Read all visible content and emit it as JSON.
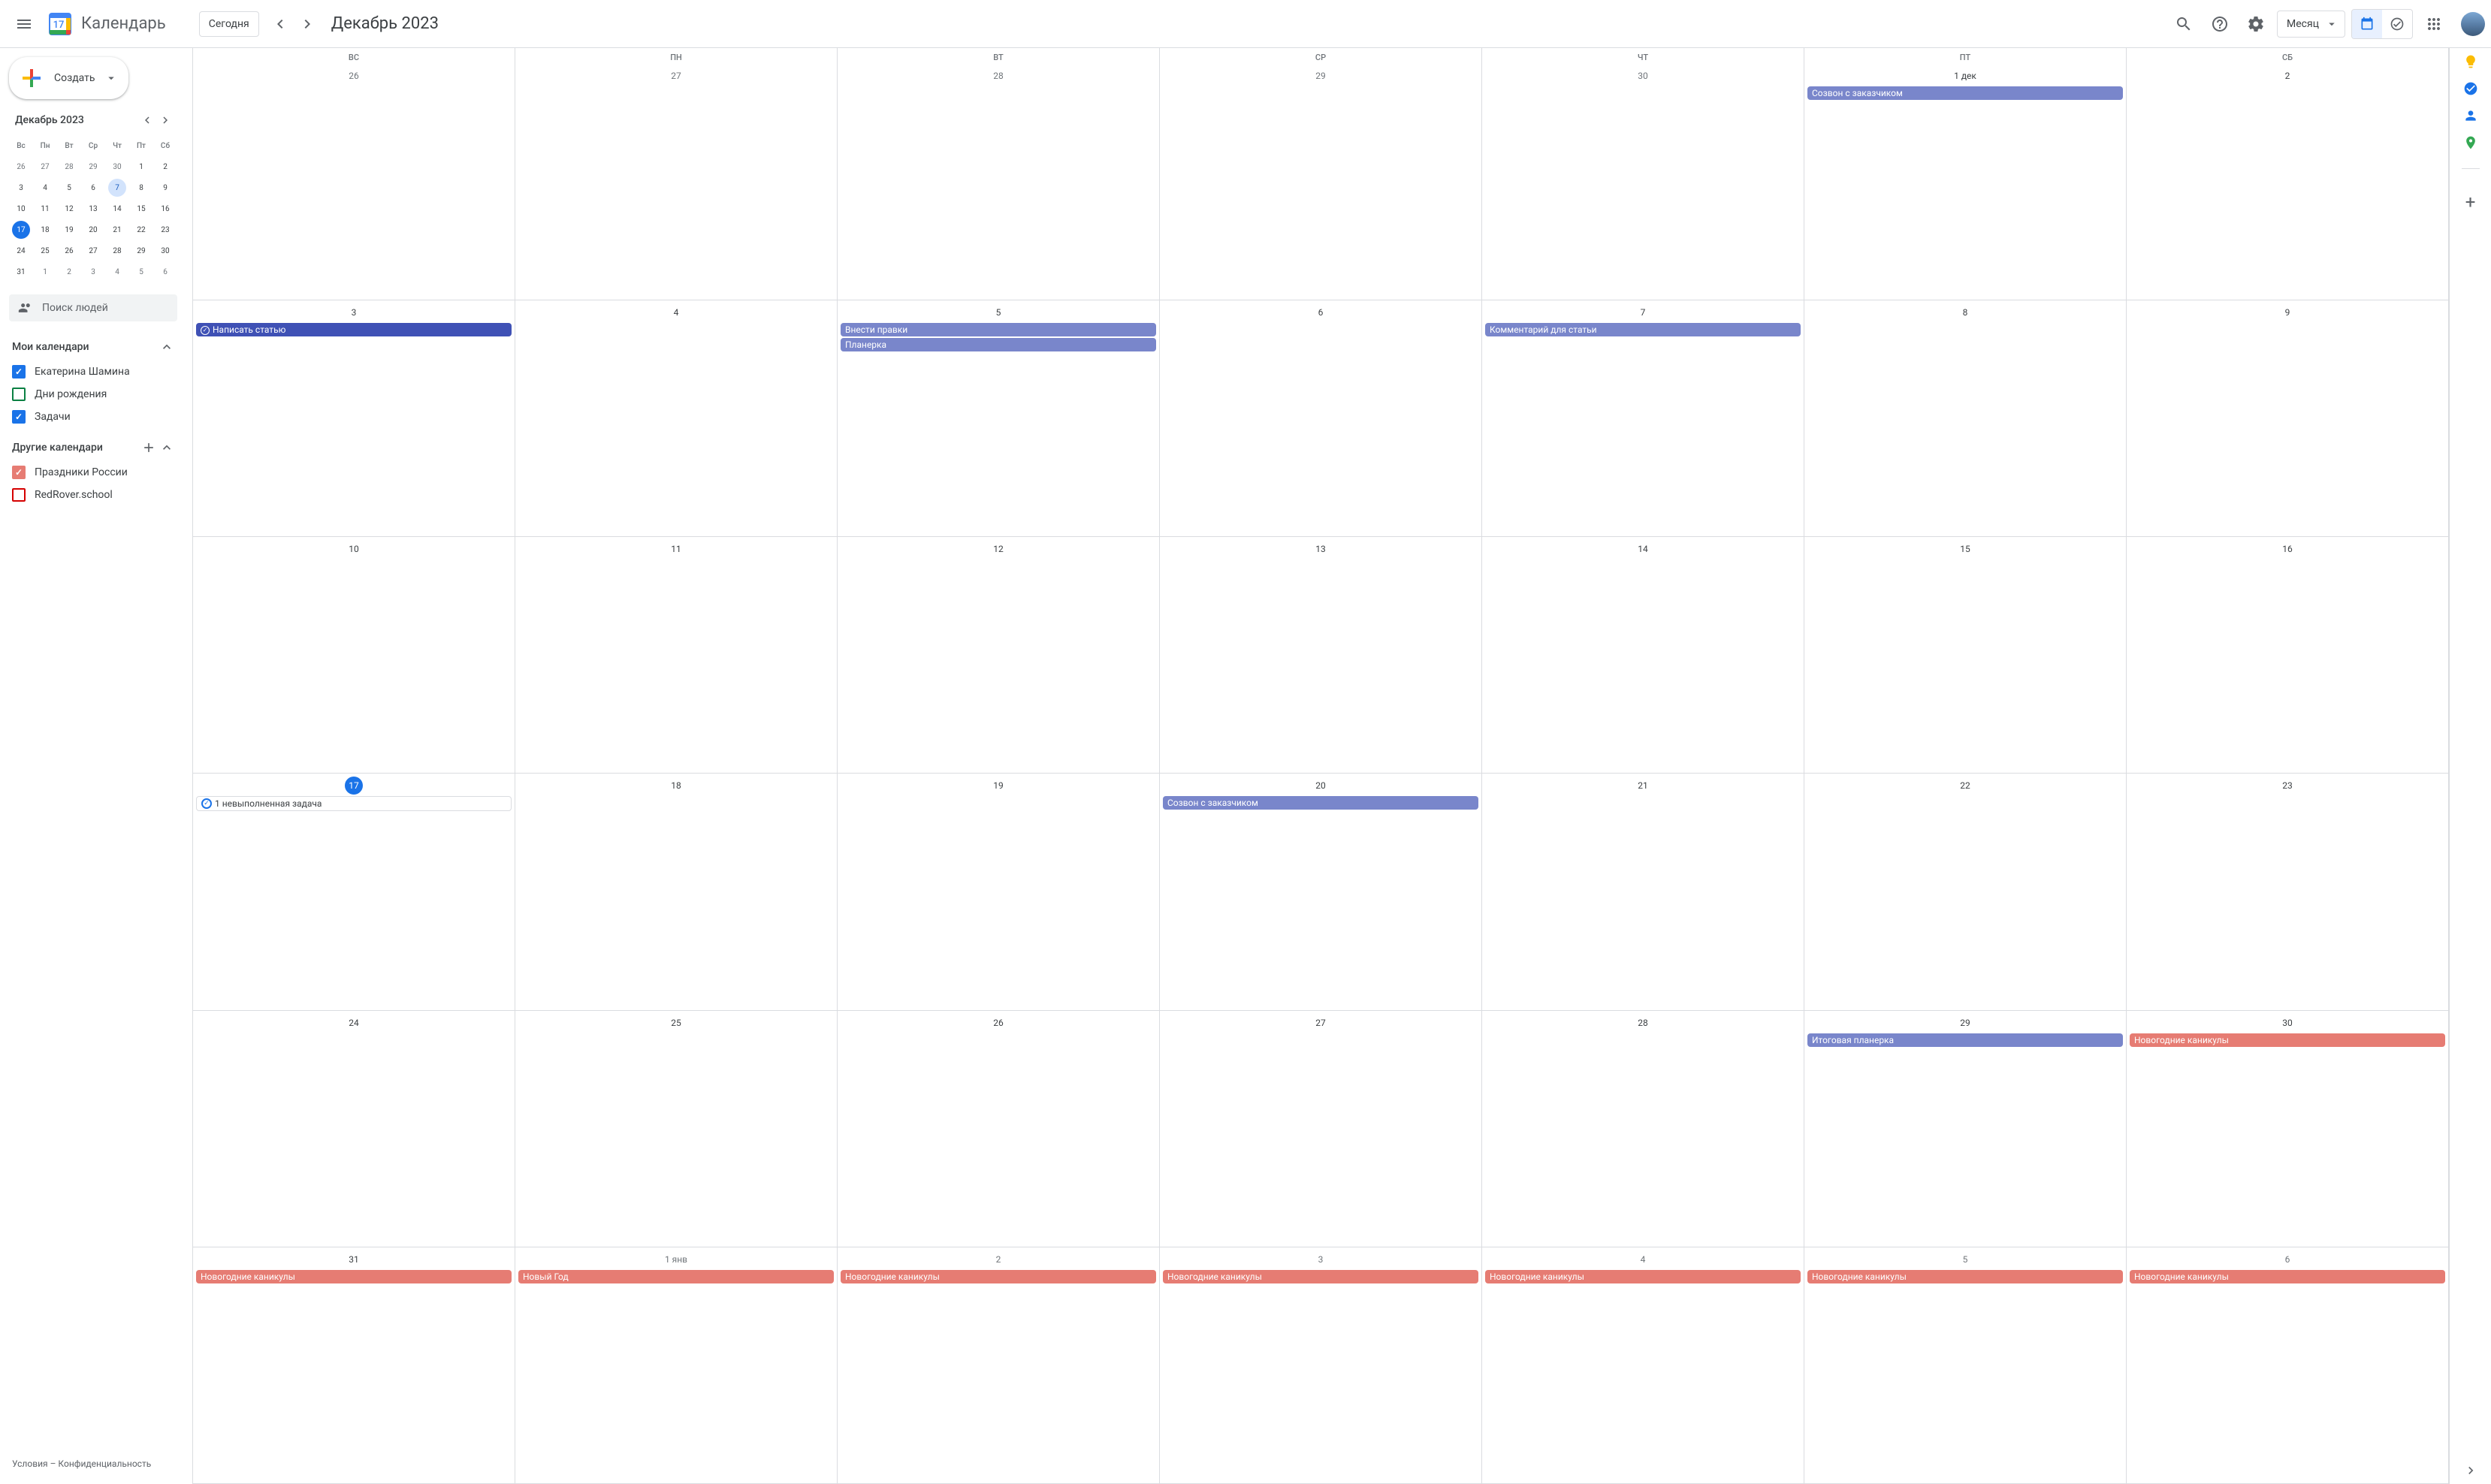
{
  "app": {
    "title": "Календарь",
    "logo_day": "17"
  },
  "header": {
    "today": "Сегодня",
    "month_title": "Декабрь 2023",
    "view": "Месяц"
  },
  "sidebar": {
    "create": "Создать",
    "mini_cal_title": "Декабрь 2023",
    "dow": [
      "Вс",
      "Пн",
      "Вт",
      "Ср",
      "Чт",
      "Пт",
      "Сб"
    ],
    "mini_days": [
      {
        "n": "26",
        "cls": "other-month"
      },
      {
        "n": "27",
        "cls": "other-month"
      },
      {
        "n": "28",
        "cls": "other-month"
      },
      {
        "n": "29",
        "cls": "other-month"
      },
      {
        "n": "30",
        "cls": "other-month"
      },
      {
        "n": "1",
        "cls": "day"
      },
      {
        "n": "2",
        "cls": "day"
      },
      {
        "n": "3",
        "cls": "day"
      },
      {
        "n": "4",
        "cls": "day"
      },
      {
        "n": "5",
        "cls": "day"
      },
      {
        "n": "6",
        "cls": "day"
      },
      {
        "n": "7",
        "cls": "highlight"
      },
      {
        "n": "8",
        "cls": "day"
      },
      {
        "n": "9",
        "cls": "day"
      },
      {
        "n": "10",
        "cls": "day"
      },
      {
        "n": "11",
        "cls": "day"
      },
      {
        "n": "12",
        "cls": "day"
      },
      {
        "n": "13",
        "cls": "day"
      },
      {
        "n": "14",
        "cls": "day"
      },
      {
        "n": "15",
        "cls": "day"
      },
      {
        "n": "16",
        "cls": "day"
      },
      {
        "n": "17",
        "cls": "today"
      },
      {
        "n": "18",
        "cls": "day"
      },
      {
        "n": "19",
        "cls": "day"
      },
      {
        "n": "20",
        "cls": "day"
      },
      {
        "n": "21",
        "cls": "day"
      },
      {
        "n": "22",
        "cls": "day"
      },
      {
        "n": "23",
        "cls": "day"
      },
      {
        "n": "24",
        "cls": "day"
      },
      {
        "n": "25",
        "cls": "day"
      },
      {
        "n": "26",
        "cls": "day"
      },
      {
        "n": "27",
        "cls": "day"
      },
      {
        "n": "28",
        "cls": "day"
      },
      {
        "n": "29",
        "cls": "day"
      },
      {
        "n": "30",
        "cls": "day"
      },
      {
        "n": "31",
        "cls": "day"
      },
      {
        "n": "1",
        "cls": "other-month"
      },
      {
        "n": "2",
        "cls": "other-month"
      },
      {
        "n": "3",
        "cls": "other-month"
      },
      {
        "n": "4",
        "cls": "other-month"
      },
      {
        "n": "5",
        "cls": "other-month"
      },
      {
        "n": "6",
        "cls": "other-month"
      }
    ],
    "search_people": "Поиск людей",
    "my_calendars": "Мои календари",
    "my_cal_items": [
      {
        "label": "Екатерина Шамина",
        "color": "#1a73e8",
        "checked": true
      },
      {
        "label": "Дни рождения",
        "color": "#0b8043",
        "checked": false
      },
      {
        "label": "Задачи",
        "color": "#1a73e8",
        "checked": true
      }
    ],
    "other_calendars": "Другие календари",
    "other_cal_items": [
      {
        "label": "Праздники России",
        "color": "#e67c73",
        "checked": true
      },
      {
        "label": "RedRover.school",
        "color": "#d50000",
        "checked": false
      }
    ],
    "footer_terms": "Условия",
    "footer_privacy": "Конфиденциальность"
  },
  "calendar": {
    "dow": [
      "ВС",
      "ПН",
      "ВТ",
      "СР",
      "ЧТ",
      "ПТ",
      "СБ"
    ],
    "weeks": [
      [
        {
          "n": "26",
          "other": true
        },
        {
          "n": "27",
          "other": true
        },
        {
          "n": "28",
          "other": true
        },
        {
          "n": "29",
          "other": true
        },
        {
          "n": "30",
          "other": true
        },
        {
          "n": "1 дек",
          "events": [
            {
              "t": "Созвон с заказчиком",
              "c": "lavender"
            }
          ]
        },
        {
          "n": "2"
        }
      ],
      [
        {
          "n": "3",
          "events": [
            {
              "t": "Написать статью",
              "c": "blue",
              "task": true
            }
          ]
        },
        {
          "n": "4"
        },
        {
          "n": "5",
          "events": [
            {
              "t": "Внести правки",
              "c": "lavender"
            },
            {
              "t": "Планерка",
              "c": "lavender"
            }
          ]
        },
        {
          "n": "6"
        },
        {
          "n": "7",
          "events": [
            {
              "t": "Комментарий для статьи",
              "c": "lavender"
            }
          ]
        },
        {
          "n": "8"
        },
        {
          "n": "9"
        }
      ],
      [
        {
          "n": "10"
        },
        {
          "n": "11"
        },
        {
          "n": "12"
        },
        {
          "n": "13"
        },
        {
          "n": "14"
        },
        {
          "n": "15"
        },
        {
          "n": "16"
        }
      ],
      [
        {
          "n": "17",
          "today": true,
          "events": [
            {
              "t": "1 невыполненная задача",
              "c": "task"
            }
          ]
        },
        {
          "n": "18"
        },
        {
          "n": "19"
        },
        {
          "n": "20",
          "events": [
            {
              "t": "Созвон с заказчиком",
              "c": "lavender"
            }
          ]
        },
        {
          "n": "21"
        },
        {
          "n": "22"
        },
        {
          "n": "23"
        }
      ],
      [
        {
          "n": "24"
        },
        {
          "n": "25"
        },
        {
          "n": "26"
        },
        {
          "n": "27"
        },
        {
          "n": "28"
        },
        {
          "n": "29",
          "events": [
            {
              "t": "Итоговая планерка",
              "c": "lavender"
            }
          ]
        },
        {
          "n": "30",
          "events": [
            {
              "t": "Новогодние каникулы",
              "c": "salmon"
            }
          ]
        }
      ],
      [
        {
          "n": "31",
          "events": [
            {
              "t": "Новогодние каникулы",
              "c": "salmon"
            }
          ]
        },
        {
          "n": "1 янв",
          "other": true,
          "events": [
            {
              "t": "Новый Год",
              "c": "salmon"
            }
          ]
        },
        {
          "n": "2",
          "other": true,
          "events": [
            {
              "t": "Новогодние каникулы",
              "c": "salmon"
            }
          ]
        },
        {
          "n": "3",
          "other": true,
          "events": [
            {
              "t": "Новогодние каникулы",
              "c": "salmon"
            }
          ]
        },
        {
          "n": "4",
          "other": true,
          "events": [
            {
              "t": "Новогодние каникулы",
              "c": "salmon"
            }
          ]
        },
        {
          "n": "5",
          "other": true,
          "events": [
            {
              "t": "Новогодние каникулы",
              "c": "salmon"
            }
          ]
        },
        {
          "n": "6",
          "other": true,
          "events": [
            {
              "t": "Новогодние каникулы",
              "c": "salmon"
            }
          ]
        }
      ]
    ]
  }
}
